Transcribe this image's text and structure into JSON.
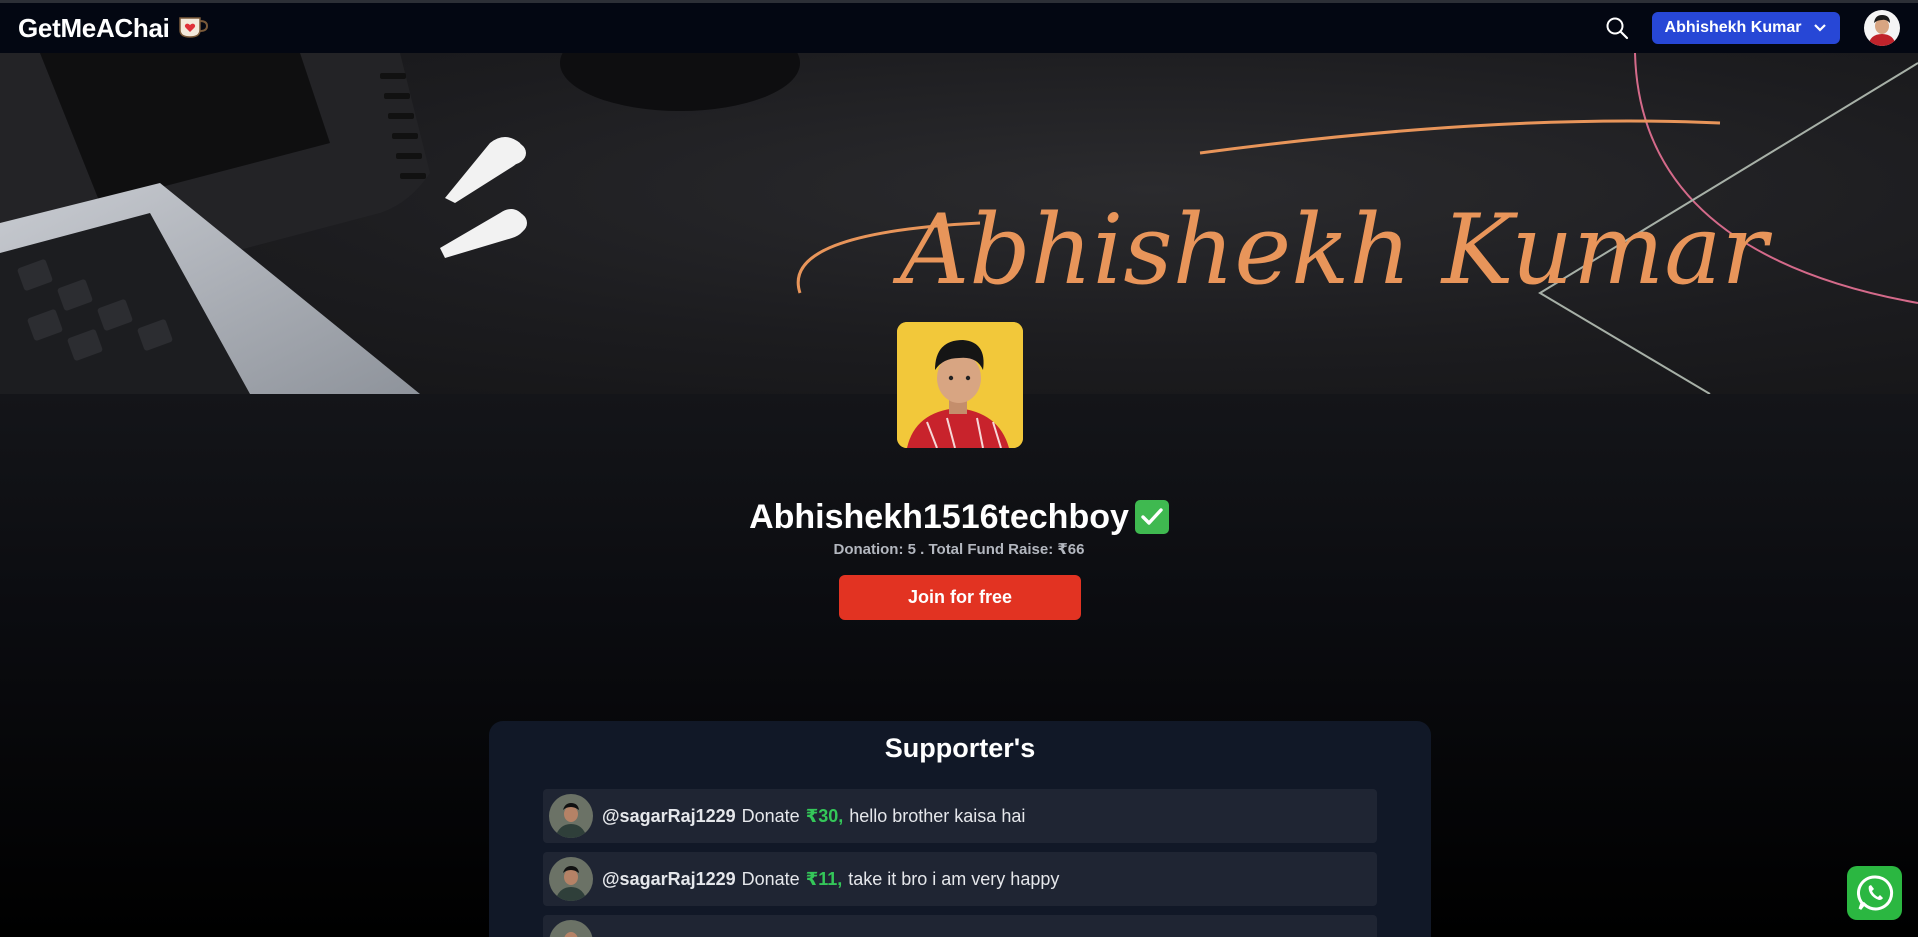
{
  "nav": {
    "brand": "GetMeAChai",
    "brand_icon": "tea-cup-heart-icon",
    "user_button_label": "Abhishekh Kumar"
  },
  "banner": {
    "signature_text": "Abhishekh Kumar"
  },
  "profile": {
    "username": "Abhishekh1516techboy",
    "stats": "Donation: 5 . Total Fund Raise: ₹66",
    "join_label": "Join for free"
  },
  "supporters": {
    "title": "Supporter's",
    "items": [
      {
        "handle": "@sagarRaj1229",
        "word": "Donate",
        "amount": "₹30,",
        "message": "hello brother kaisa hai"
      },
      {
        "handle": "@sagarRaj1229",
        "word": "Donate",
        "amount": "₹11,",
        "message": "take it bro i am very happy"
      }
    ]
  },
  "colors": {
    "nav_bg": "#030712",
    "user_button": "#2747d6",
    "join_button": "#e23322",
    "amount_green": "#34c759",
    "supporter_card": "#111827",
    "supporter_row": "#1f2533",
    "signature": "#e8955a",
    "whatsapp": "#2bb741"
  }
}
